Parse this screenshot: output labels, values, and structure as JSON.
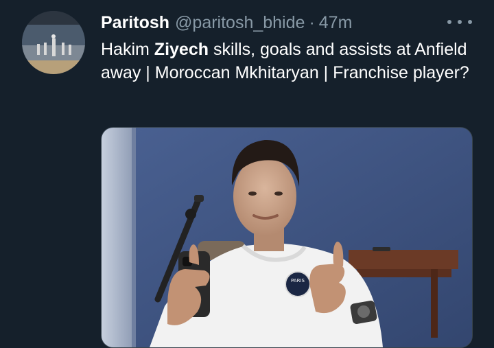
{
  "tweet": {
    "display_name": "Paritosh",
    "handle": "@paritosh_bhide",
    "separator": "·",
    "time": "47m",
    "text_parts": {
      "t1": "Hakim ",
      "t2": "Ziyech",
      "t3": " skills, goals and assists at Anfield away | Moroccan Mkhitaryan | Franchise player?"
    }
  },
  "media": {
    "shirt_badge_text": "PARIS"
  },
  "icons": {
    "more": "more-options-icon"
  },
  "colors": {
    "background": "#15202b",
    "secondary_text": "#8899a6",
    "primary_text": "#ffffff",
    "border": "#38444d"
  }
}
